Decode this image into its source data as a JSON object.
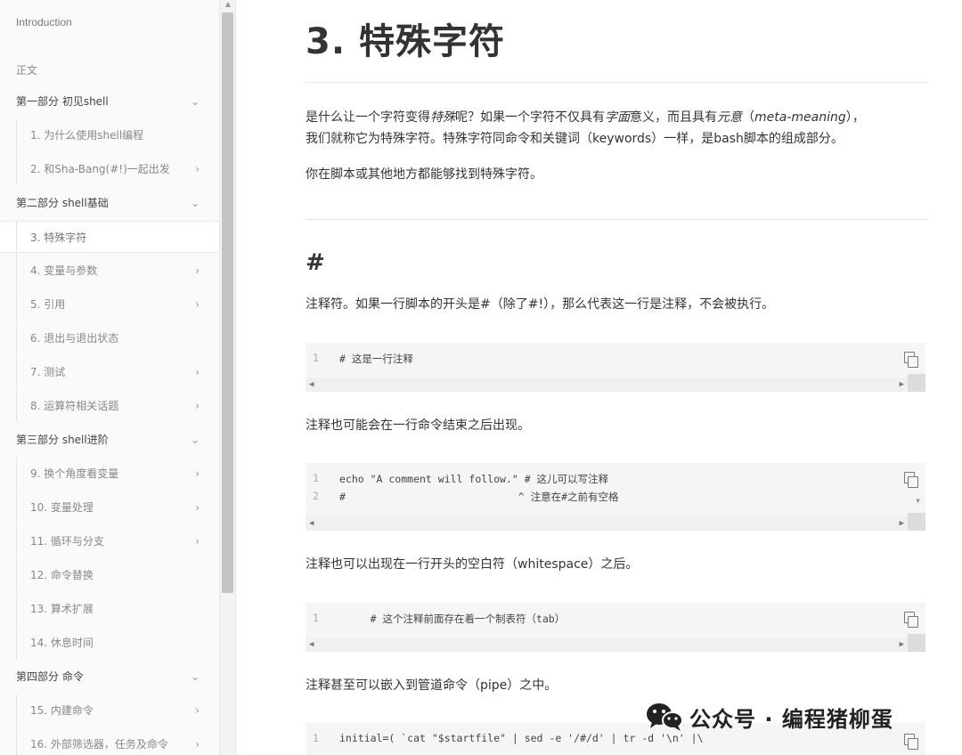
{
  "sidebar": {
    "title": "Introduction",
    "section_label": "正文",
    "items": [
      {
        "label": "第一部分 初见shell",
        "kind": "part",
        "chevron": "⌄"
      },
      {
        "label": "1. 为什么使用shell编程",
        "kind": "sub",
        "chevron": ""
      },
      {
        "label": "2. 和Sha-Bang(#!)一起出发",
        "kind": "sub",
        "chevron": "›"
      },
      {
        "label": "第二部分 shell基础",
        "kind": "part",
        "chevron": "⌄"
      },
      {
        "label": "3. 特殊字符",
        "kind": "sub",
        "chevron": "",
        "active": true
      },
      {
        "label": "4. 变量与参数",
        "kind": "sub",
        "chevron": "›"
      },
      {
        "label": "5. 引用",
        "kind": "sub",
        "chevron": "›"
      },
      {
        "label": "6. 退出与退出状态",
        "kind": "sub",
        "chevron": ""
      },
      {
        "label": "7. 测试",
        "kind": "sub",
        "chevron": "›"
      },
      {
        "label": "8. 运算符相关话题",
        "kind": "sub",
        "chevron": "›"
      },
      {
        "label": "第三部分 shell进阶",
        "kind": "part",
        "chevron": "⌄"
      },
      {
        "label": "9. 换个角度看变量",
        "kind": "sub",
        "chevron": "›"
      },
      {
        "label": "10. 变量处理",
        "kind": "sub",
        "chevron": "›"
      },
      {
        "label": "11. 循环与分支",
        "kind": "sub",
        "chevron": "›"
      },
      {
        "label": "12. 命令替换",
        "kind": "sub",
        "chevron": ""
      },
      {
        "label": "13. 算术扩展",
        "kind": "sub",
        "chevron": ""
      },
      {
        "label": "14. 休息时间",
        "kind": "sub",
        "chevron": ""
      },
      {
        "label": "第四部分 命令",
        "kind": "part",
        "chevron": "⌄"
      },
      {
        "label": "15. 内建命令",
        "kind": "sub",
        "chevron": "›"
      },
      {
        "label": "16. 外部筛选器，任务及命令",
        "kind": "sub",
        "chevron": "›"
      }
    ]
  },
  "main": {
    "title": "3. 特殊字符",
    "intro_p1_a": "是什么让一个字符变得",
    "intro_p1_em1": "特殊",
    "intro_p1_b": "呢？如果一个字符不仅具有",
    "intro_p1_em2": "字面",
    "intro_p1_c": "意义，而且具有",
    "intro_p1_em3": "元意",
    "intro_p1_d": "（",
    "intro_p1_em4": "meta-meaning",
    "intro_p1_e": "），",
    "intro_p1_line2": "我们就称它为特殊字符。特殊字符同命令和关键词（keywords）一样，是bash脚本的组成部分。",
    "intro_p2": "你在脚本或其他地方都能够找到特殊字符。",
    "section_heading": "#",
    "desc1": "注释符。如果一行脚本的开头是#（除了#!），那么代表这一行是注释，不会被执行。",
    "code1": [
      {
        "n": "1",
        "text": "# 这是一行注释"
      }
    ],
    "desc2": "注释也可能会在一行命令结束之后出现。",
    "code2": [
      {
        "n": "1",
        "text": "echo \"A comment will follow.\" # 这儿可以写注释"
      },
      {
        "n": "2",
        "text": "#                            ^ 注意在#之前有空格"
      }
    ],
    "desc3": "注释也可以出现在一行开头的空白符（whitespace）之后。",
    "code3": [
      {
        "n": "1",
        "text": "     # 这个注释前面存在着一个制表符（tab）"
      }
    ],
    "desc4": "注释甚至可以嵌入到管道命令（pipe）之中。",
    "code4": [
      {
        "n": "1",
        "text": "initial=( `cat \"$startfile\" | sed -e '/#/d' | tr -d '\\n' |\\"
      }
    ]
  },
  "watermark": {
    "text": "公众号 · 编程猪柳蛋",
    "icon": "wechat-icon"
  }
}
